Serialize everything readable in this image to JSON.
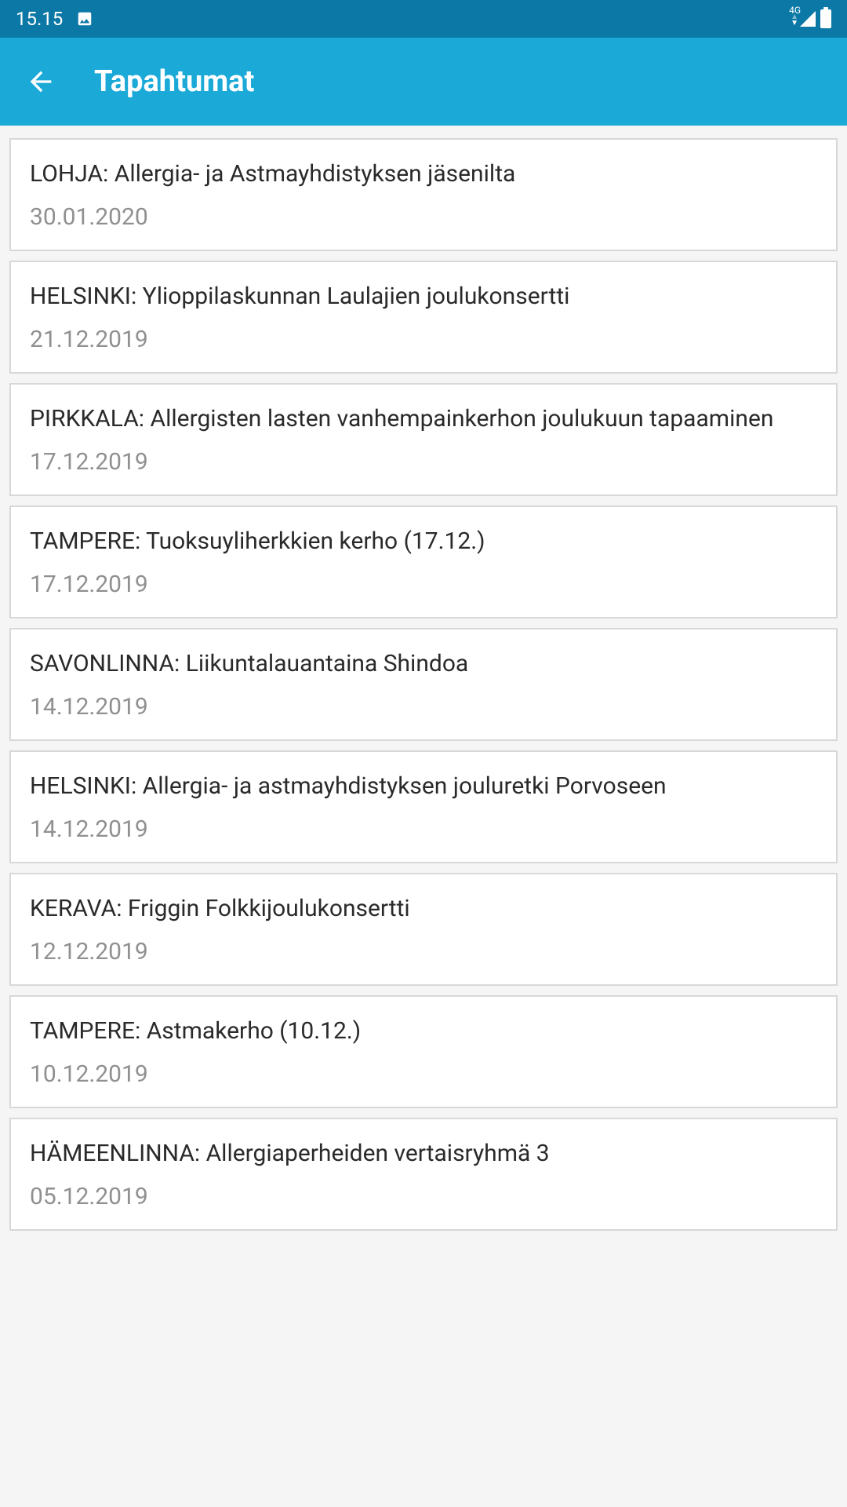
{
  "status": {
    "time": "15.15",
    "network": "4G"
  },
  "header": {
    "title": "Tapahtumat"
  },
  "events": [
    {
      "title": "LOHJA: Allergia- ja Astmayhdistyksen jäsenilta",
      "date": "30.01.2020"
    },
    {
      "title": "HELSINKI: Ylioppilaskunnan Laulajien joulukonsertti",
      "date": "21.12.2019"
    },
    {
      "title": "PIRKKALA: Allergisten lasten vanhempainkerhon joulukuun tapaaminen",
      "date": "17.12.2019"
    },
    {
      "title": "TAMPERE: Tuoksuyliherkkien kerho (17.12.)",
      "date": "17.12.2019"
    },
    {
      "title": "SAVONLINNA: Liikuntalauantaina Shindoa",
      "date": "14.12.2019"
    },
    {
      "title": "HELSINKI: Allergia- ja astmayhdistyksen jouluretki Porvoseen",
      "date": "14.12.2019"
    },
    {
      "title": "KERAVA: Friggin Folkkijoulukonsertti",
      "date": "12.12.2019"
    },
    {
      "title": "TAMPERE: Astmakerho (10.12.)",
      "date": "10.12.2019"
    },
    {
      "title": "HÄMEENLINNA: Allergiaperheiden vertaisryhmä 3",
      "date": "05.12.2019"
    }
  ]
}
